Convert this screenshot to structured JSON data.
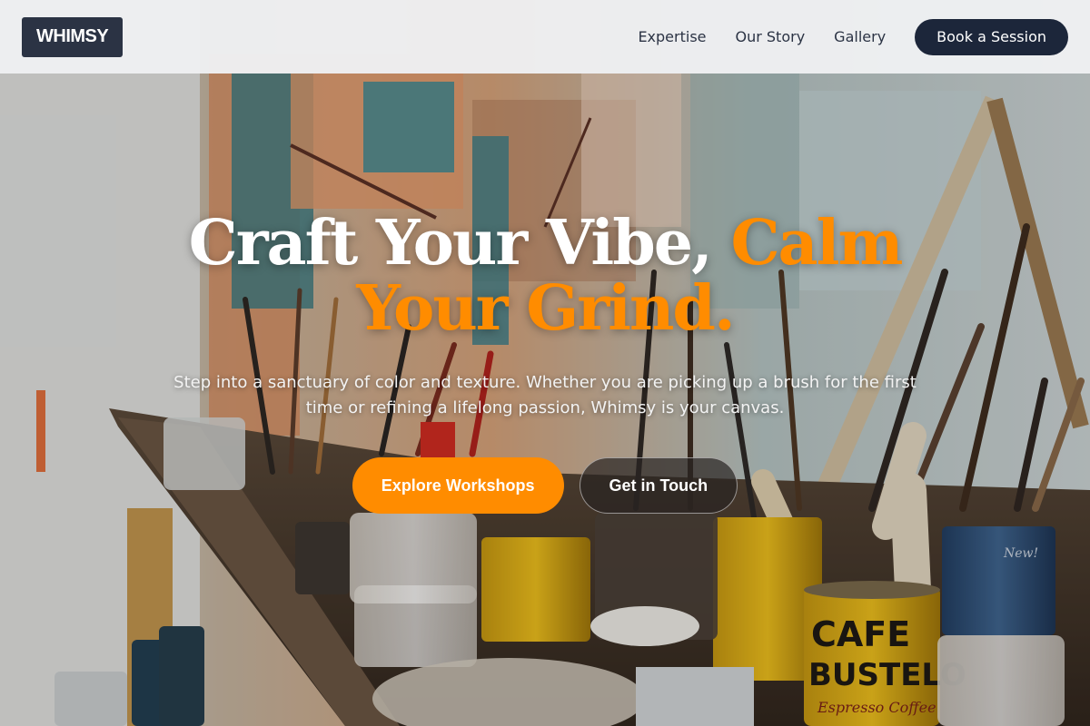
{
  "brand": {
    "logo_text": "WHIMSY"
  },
  "nav": {
    "links": [
      "Expertise",
      "Our Story",
      "Gallery"
    ],
    "cta_label": "Book a Session"
  },
  "hero": {
    "headline_main": "Craft Your Vibe,",
    "headline_accent": "Calm Your Grind.",
    "subtext": "Step into a sanctuary of color and texture. Whether you are picking up a brush for the first time or refining a lifelong passion, Whimsy is your canvas.",
    "primary_cta": "Explore Workshops",
    "secondary_cta": "Get in Touch",
    "background_image_labels": [
      "CAFE",
      "BUSTELO",
      "Espresso Coffee",
      "New!"
    ]
  },
  "colors": {
    "accent": "#ff8c00",
    "navy": "#1c263a",
    "logo_bg": "#2b3344",
    "header_bg": "#eef0f2"
  }
}
